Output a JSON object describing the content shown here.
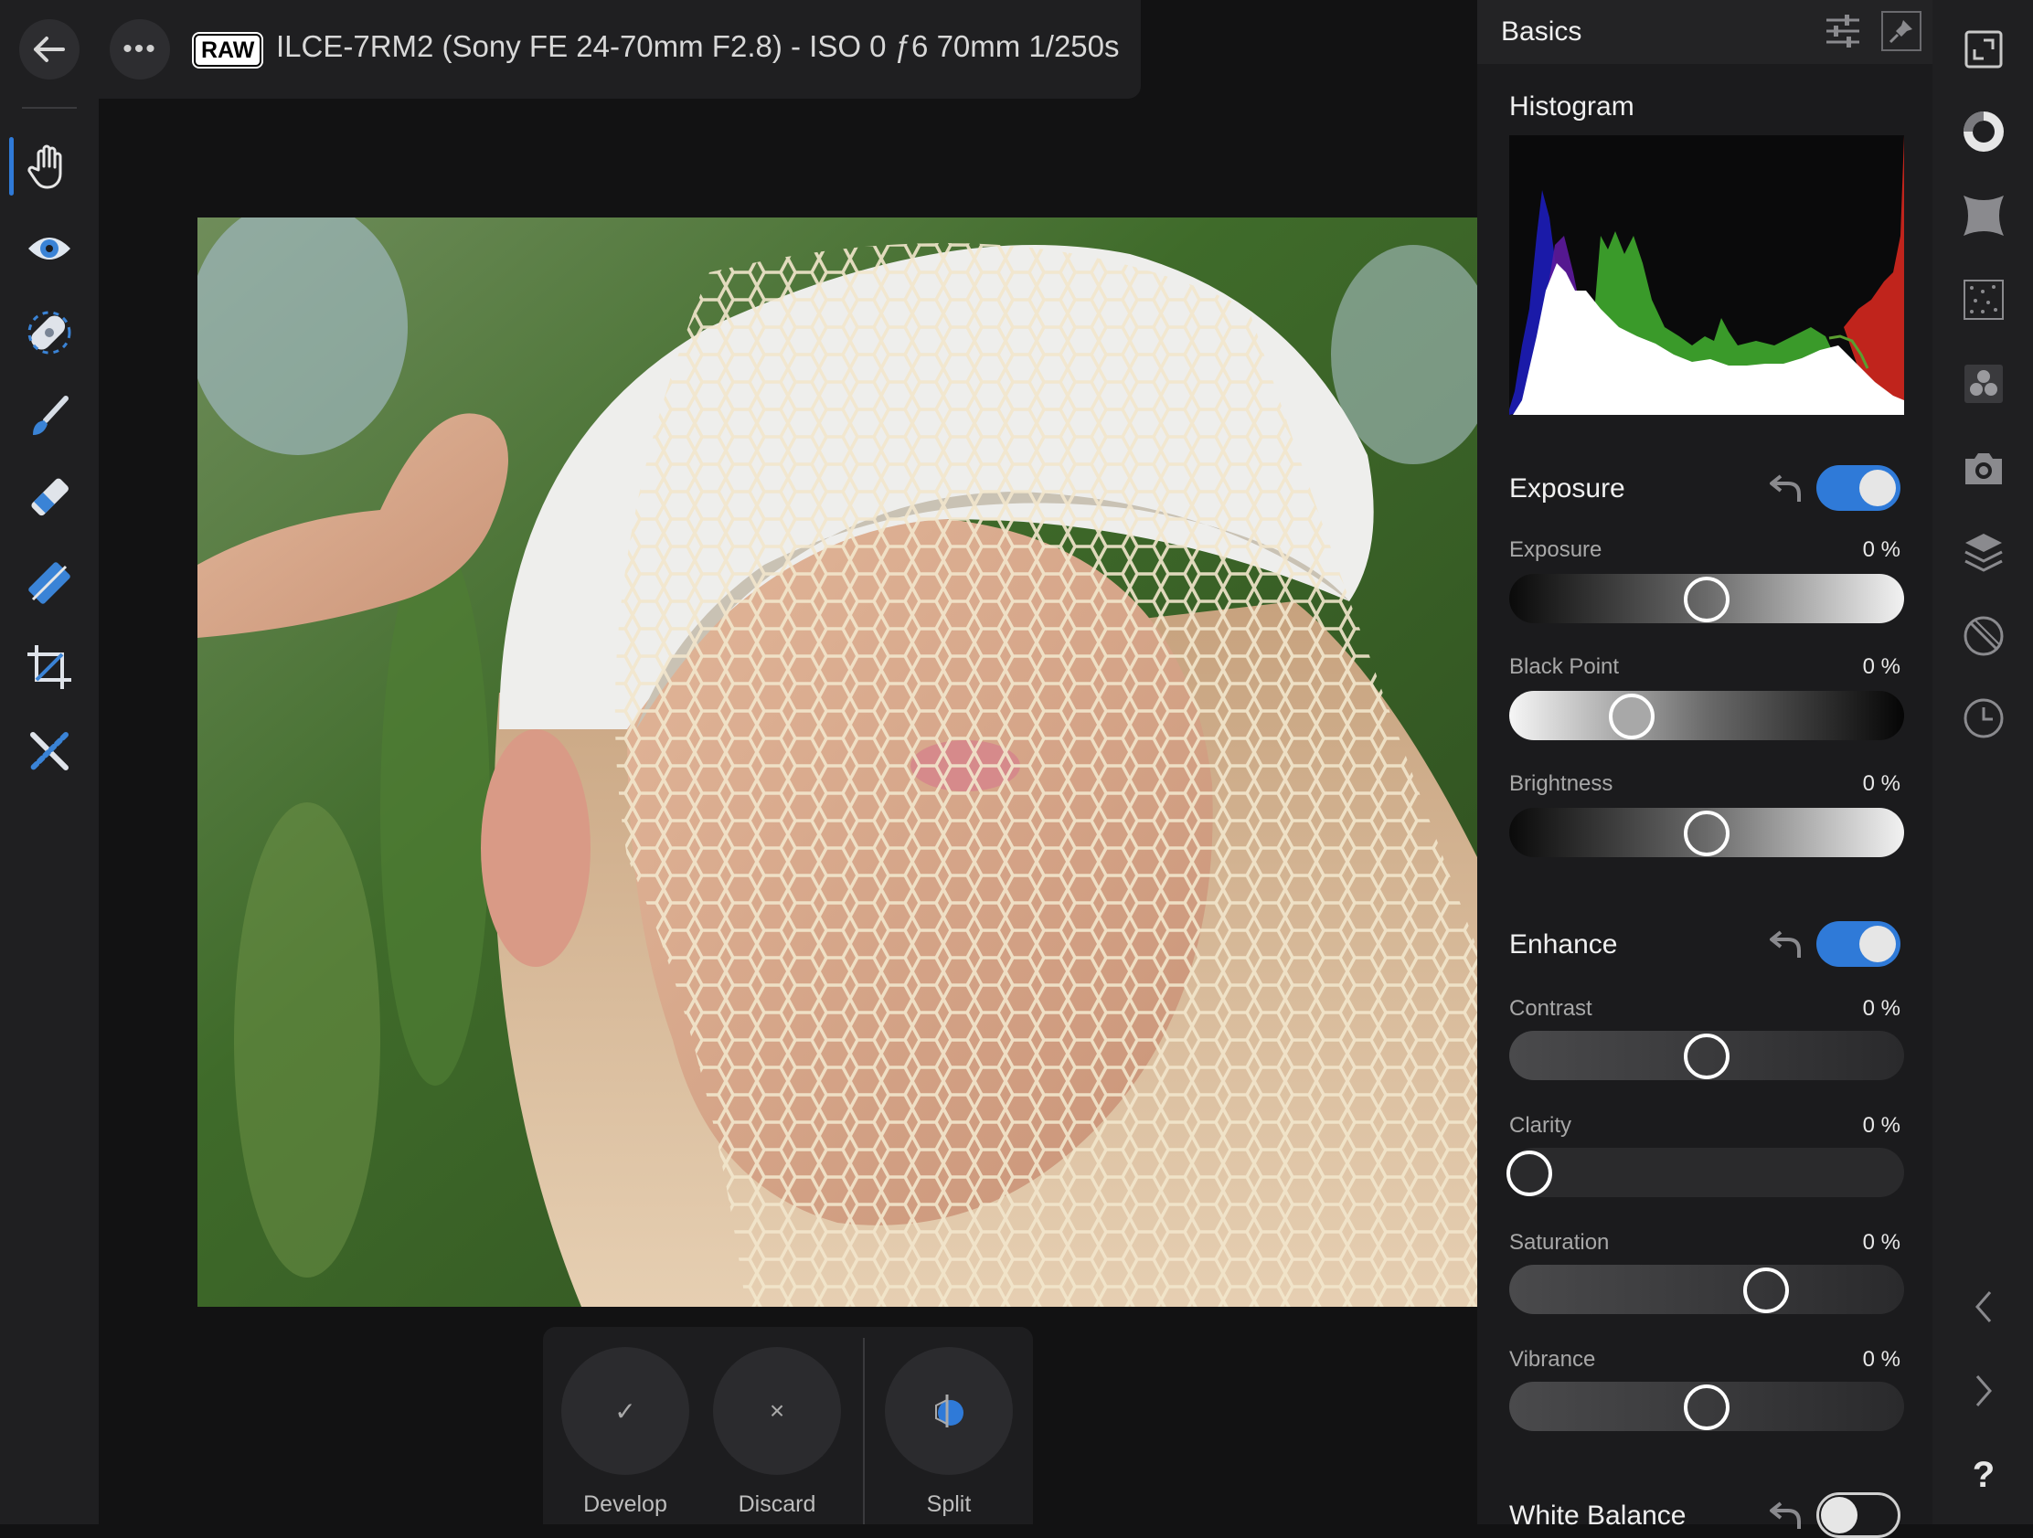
{
  "header": {
    "raw_badge": "RAW",
    "camera_info": "ILCE-7RM2 (Sony FE 24-70mm F2.8) - ISO 0 ƒ6 70mm 1/250s"
  },
  "left_tools": [
    "hand-tool",
    "red-eye-tool",
    "blemish-tool",
    "brush-tool",
    "eraser-tool",
    "gradient-tool",
    "crop-tool",
    "selection-tool"
  ],
  "actions": {
    "develop": {
      "label": "Develop",
      "glyph": "✓"
    },
    "discard": {
      "label": "Discard",
      "glyph": "×"
    },
    "split": {
      "label": "Split"
    }
  },
  "panel": {
    "title": "Basics",
    "histogram_label": "Histogram",
    "exposure": {
      "title": "Exposure",
      "enabled": true,
      "rows": [
        {
          "label": "Exposure",
          "value": "0 %",
          "level": 0.5
        },
        {
          "label": "Black Point",
          "value": "0 %",
          "level": 0.31
        },
        {
          "label": "Brightness",
          "value": "0 %",
          "level": 0.5
        }
      ]
    },
    "enhance": {
      "title": "Enhance",
      "enabled": true,
      "rows": [
        {
          "label": "Contrast",
          "value": "0 %",
          "level": 0.5
        },
        {
          "label": "Clarity",
          "value": "0 %",
          "level": 0.05
        },
        {
          "label": "Saturation",
          "value": "0 %",
          "level": 0.65
        },
        {
          "label": "Vibrance",
          "value": "0 %",
          "level": 0.5
        }
      ]
    },
    "white_balance": {
      "title": "White Balance",
      "enabled": false
    }
  },
  "colors": {
    "accent": "#2f7ad8",
    "panel_bg": "#1b1b1d"
  },
  "right_strip_icons": [
    "fullscreen-icon",
    "tone-icon",
    "vignette-icon",
    "noise-icon",
    "color-icon",
    "camera-icon",
    "layers-icon",
    "lens-icon",
    "history-icon"
  ]
}
